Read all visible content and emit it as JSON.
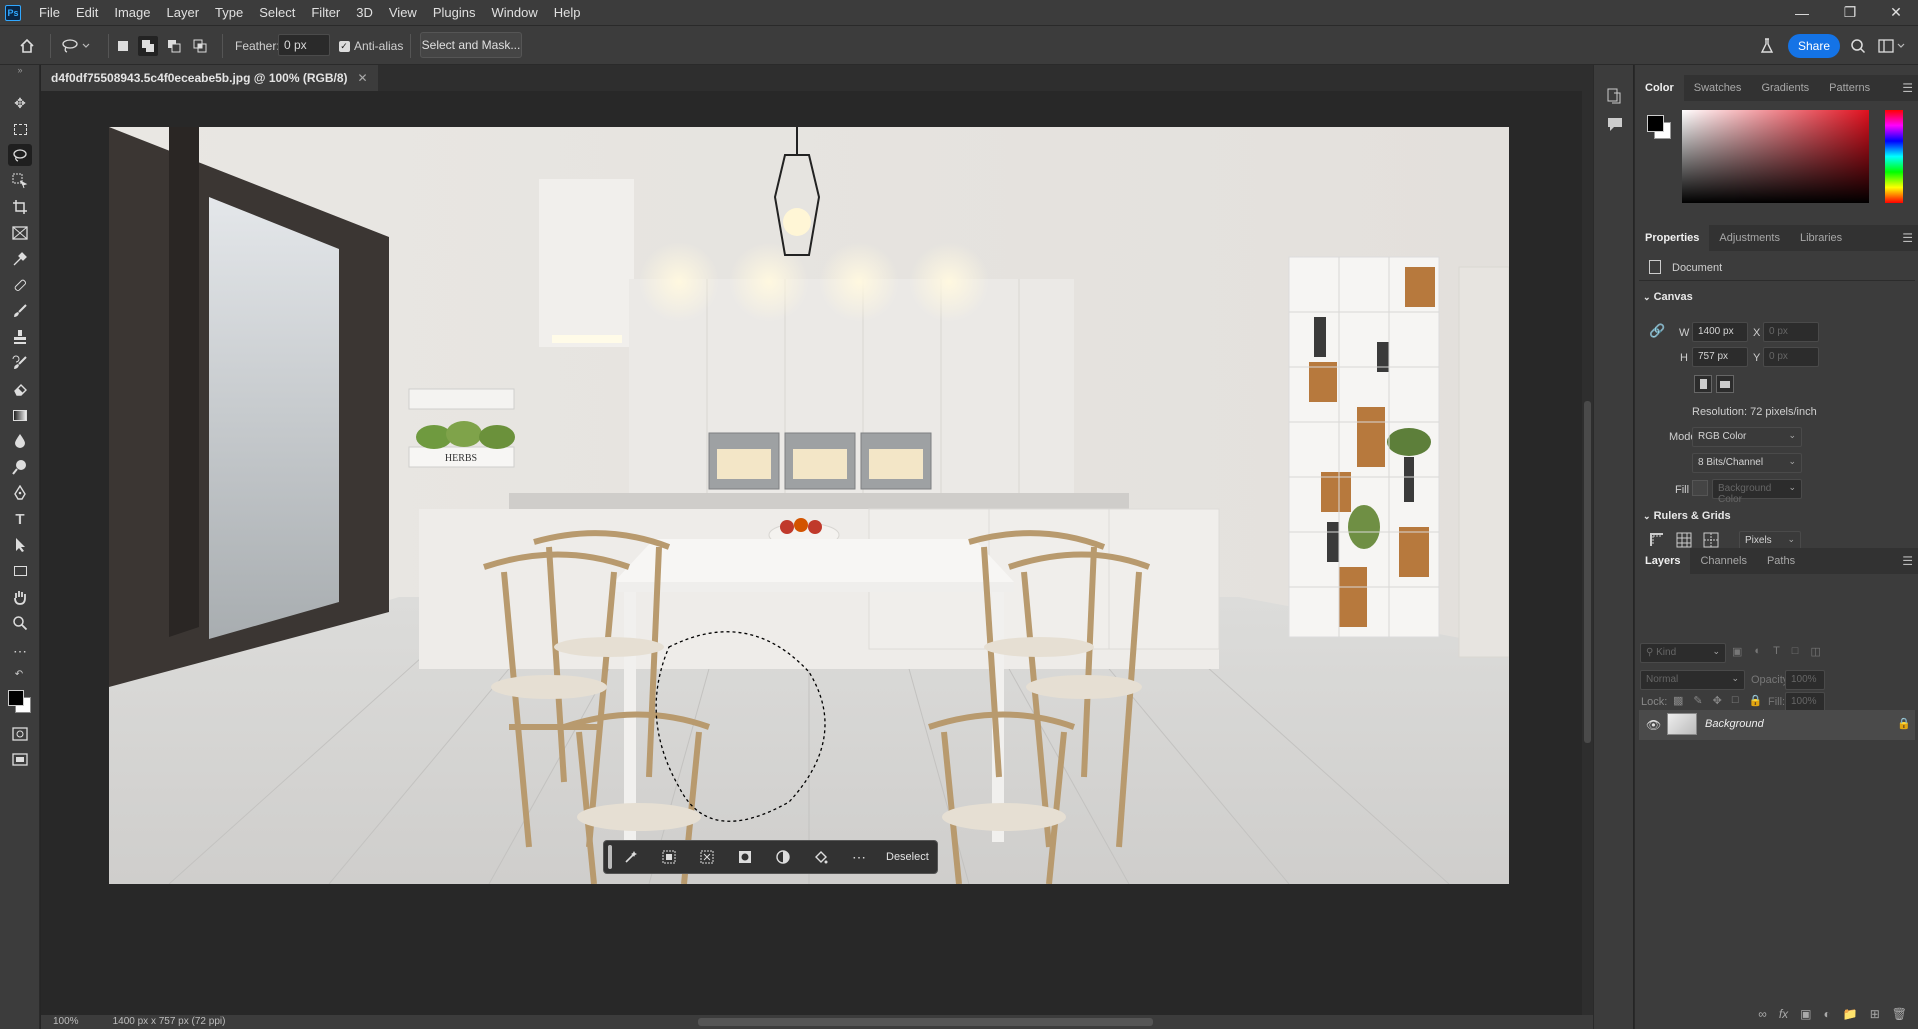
{
  "app": {
    "logo": "Ps"
  },
  "menu": [
    "File",
    "Edit",
    "Image",
    "Layer",
    "Type",
    "Select",
    "Filter",
    "3D",
    "View",
    "Plugins",
    "Window",
    "Help"
  ],
  "options_bar": {
    "feather_label": "Feather:",
    "feather_value": "0 px",
    "antialias_label": "Anti-alias",
    "antialias_checked": true,
    "select_and_mask": "Select and Mask...",
    "share": "Share"
  },
  "document": {
    "tab_title": "d4f0df75508943.5c4f0eceabe5b.jpg @ 100% (RGB/8)",
    "zoom": "100%",
    "info": "1400 px x 757 px (72 ppi)"
  },
  "image": {
    "sign_text": "HERBS"
  },
  "context_bar": {
    "deselect": "Deselect"
  },
  "color_panel": {
    "tabs": [
      "Color",
      "Swatches",
      "Gradients",
      "Patterns"
    ],
    "active": 0,
    "fg": "#000000",
    "bg": "#ffffff"
  },
  "properties_panel": {
    "tabs": [
      "Properties",
      "Adjustments",
      "Libraries"
    ],
    "doc_label": "Document",
    "canvas_header": "Canvas",
    "w_label": "W",
    "w_value": "1400 px",
    "h_label": "H",
    "h_value": "757 px",
    "x_label": "X",
    "x_value": "0 px",
    "y_label": "Y",
    "y_value": "0 px",
    "resolution": "Resolution: 72 pixels/inch",
    "mode_label": "Mode",
    "mode_value": "RGB Color",
    "depth_value": "8 Bits/Channel",
    "fill_label": "Fill",
    "fill_value": "Background Color",
    "rulers_header": "Rulers & Grids",
    "units_value": "Pixels"
  },
  "layers_panel": {
    "tabs": [
      "Layers",
      "Channels",
      "Paths"
    ],
    "kind_placeholder": "Kind",
    "blend_mode": "Normal",
    "opacity_label": "Opacity:",
    "opacity_value": "100%",
    "lock_label": "Lock:",
    "fill_label": "Fill:",
    "fill_value": "100%",
    "layers": [
      {
        "name": "Background",
        "visible": true,
        "locked": true
      }
    ]
  }
}
